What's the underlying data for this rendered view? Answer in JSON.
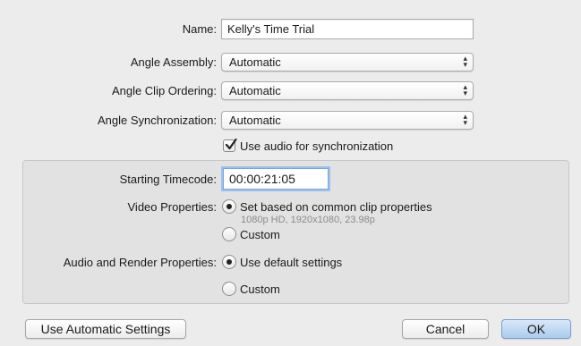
{
  "form": {
    "name": {
      "label": "Name:",
      "value": "Kelly's Time Trial"
    },
    "angle_assembly": {
      "label": "Angle Assembly:",
      "value": "Automatic"
    },
    "angle_clip_ordering": {
      "label": "Angle Clip Ordering:",
      "value": "Automatic"
    },
    "angle_synchronization": {
      "label": "Angle Synchronization:",
      "value": "Automatic"
    },
    "use_audio_sync": {
      "label": "Use audio for synchronization",
      "checked": true
    }
  },
  "properties": {
    "starting_timecode": {
      "label": "Starting Timecode:",
      "value": "00:00:21:05"
    },
    "video": {
      "label": "Video Properties:",
      "option_common": "Set based on common clip properties",
      "option_common_detail": "1080p HD, 1920x1080, 23.98p",
      "option_custom": "Custom",
      "selected": "common"
    },
    "audio_render": {
      "label": "Audio and Render Properties:",
      "option_default": "Use default settings",
      "option_custom": "Custom",
      "selected": "default"
    }
  },
  "buttons": {
    "automatic": "Use Automatic Settings",
    "cancel": "Cancel",
    "ok": "OK"
  },
  "icons": {
    "popup_arrows": "up-down-chevron-icon",
    "checkmark": "checkmark-icon"
  }
}
